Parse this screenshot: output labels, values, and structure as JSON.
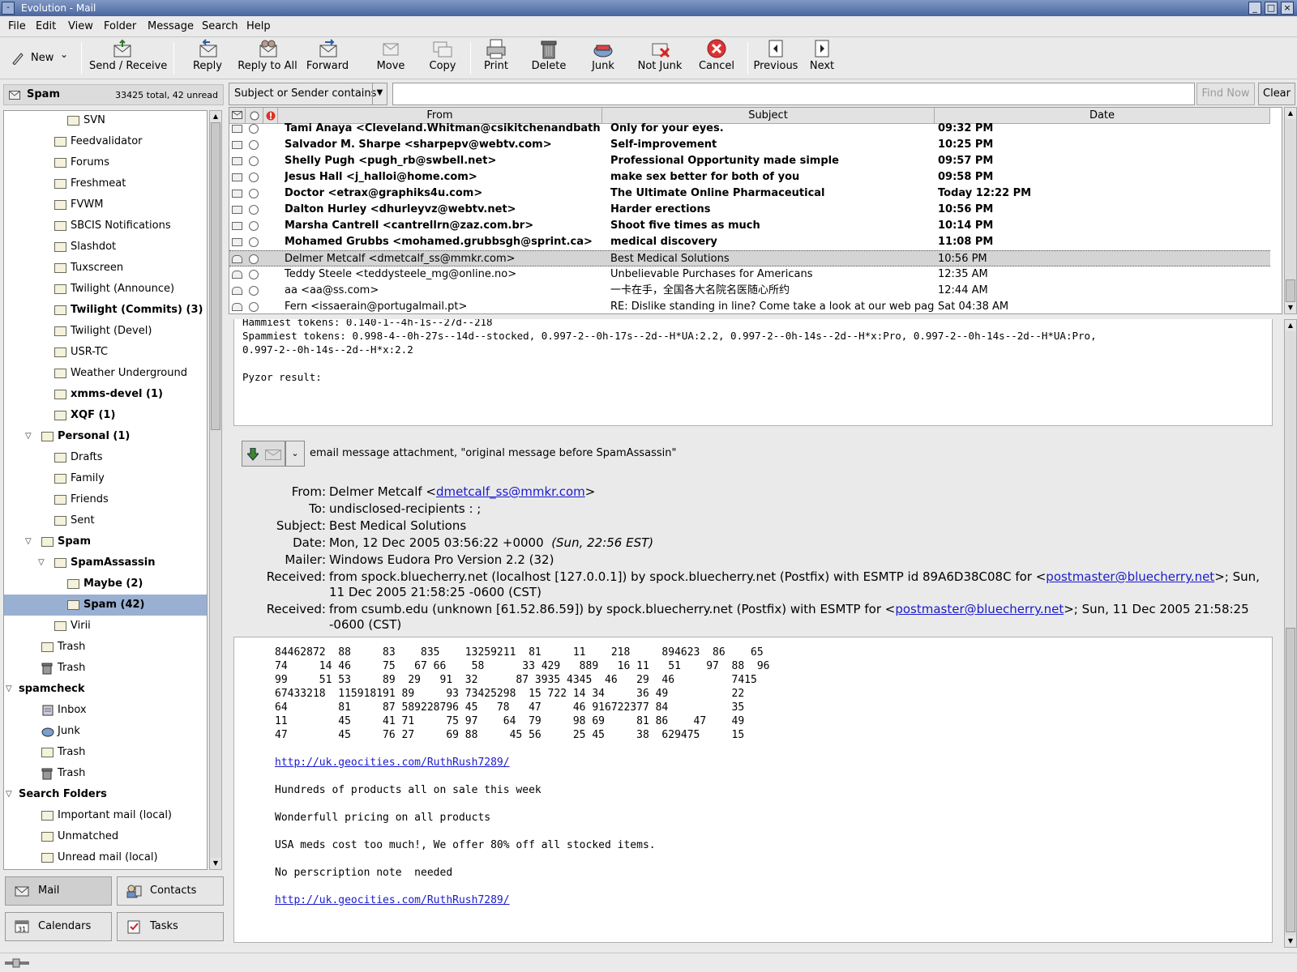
{
  "window": {
    "title": "Evolution - Mail",
    "buttons": [
      "_",
      "□",
      "×"
    ]
  },
  "menu": [
    "File",
    "Edit",
    "View",
    "Folder",
    "Message",
    "Search",
    "Help"
  ],
  "toolbar": {
    "new_label": "New",
    "buttons": [
      {
        "label": "Send / Receive",
        "icon": "send-receive-icon"
      },
      {
        "label": "Reply",
        "icon": "reply-icon"
      },
      {
        "label": "Reply to All",
        "icon": "reply-all-icon"
      },
      {
        "label": "Forward",
        "icon": "forward-icon"
      },
      {
        "label": "Move",
        "icon": "move-icon"
      },
      {
        "label": "Copy",
        "icon": "copy-icon"
      },
      {
        "label": "Print",
        "icon": "print-icon"
      },
      {
        "label": "Delete",
        "icon": "delete-icon"
      },
      {
        "label": "Junk",
        "icon": "junk-icon"
      },
      {
        "label": "Not Junk",
        "icon": "not-junk-icon"
      },
      {
        "label": "Cancel",
        "icon": "cancel-icon"
      },
      {
        "label": "Previous",
        "icon": "previous-icon"
      },
      {
        "label": "Next",
        "icon": "next-icon"
      }
    ]
  },
  "folder_header": {
    "name": "Spam",
    "counts": "33425 total, 42 unread"
  },
  "folders": [
    {
      "label": "SVN",
      "level": 3,
      "bold": false
    },
    {
      "label": "Feedvalidator",
      "level": 2,
      "bold": false
    },
    {
      "label": "Forums",
      "level": 2,
      "bold": false
    },
    {
      "label": "Freshmeat",
      "level": 2,
      "bold": false
    },
    {
      "label": "FVWM",
      "level": 2,
      "bold": false
    },
    {
      "label": "SBCIS Notifications",
      "level": 2,
      "bold": false
    },
    {
      "label": "Slashdot",
      "level": 2,
      "bold": false
    },
    {
      "label": "Tuxscreen",
      "level": 2,
      "bold": false
    },
    {
      "label": "Twilight (Announce)",
      "level": 2,
      "bold": false
    },
    {
      "label": "Twilight (Commits) (3)",
      "level": 2,
      "bold": true
    },
    {
      "label": "Twilight (Devel)",
      "level": 2,
      "bold": false
    },
    {
      "label": "USR-TC",
      "level": 2,
      "bold": false
    },
    {
      "label": "Weather Underground",
      "level": 2,
      "bold": false
    },
    {
      "label": "xmms-devel (1)",
      "level": 2,
      "bold": true
    },
    {
      "label": "XQF (1)",
      "level": 2,
      "bold": true
    },
    {
      "label": "Personal (1)",
      "level": 1,
      "bold": true,
      "expanded": true
    },
    {
      "label": "Drafts",
      "level": 2,
      "bold": false
    },
    {
      "label": "Family",
      "level": 2,
      "bold": false
    },
    {
      "label": "Friends",
      "level": 2,
      "bold": false
    },
    {
      "label": "Sent",
      "level": 2,
      "bold": false
    },
    {
      "label": "Spam",
      "level": 1,
      "bold": true,
      "expanded": true
    },
    {
      "label": "SpamAssassin",
      "level": 2,
      "bold": true,
      "expanded": true
    },
    {
      "label": "Maybe (2)",
      "level": 3,
      "bold": true
    },
    {
      "label": "Spam (42)",
      "level": 3,
      "bold": true,
      "selected": true
    },
    {
      "label": "Virii",
      "level": 2,
      "bold": false
    },
    {
      "label": "Trash",
      "level": 1,
      "bold": false
    },
    {
      "label": "Trash",
      "level": 1,
      "bold": false,
      "icon": "trash"
    },
    {
      "label": "spamcheck",
      "level": 0,
      "bold": true,
      "expanded": true
    },
    {
      "label": "Inbox",
      "level": 1,
      "bold": false,
      "icon": "inbox"
    },
    {
      "label": "Junk",
      "level": 1,
      "bold": false,
      "icon": "junk"
    },
    {
      "label": "Trash",
      "level": 1,
      "bold": false
    },
    {
      "label": "Trash",
      "level": 1,
      "bold": false,
      "icon": "trash"
    },
    {
      "label": "Search Folders",
      "level": 0,
      "bold": true,
      "expanded": true
    },
    {
      "label": "Important mail (local)",
      "level": 1,
      "bold": false
    },
    {
      "label": "Unmatched",
      "level": 1,
      "bold": false
    },
    {
      "label": "Unread mail (local)",
      "level": 1,
      "bold": false
    }
  ],
  "switcher": [
    {
      "label": "Mail",
      "icon": "mail-icon",
      "active": true
    },
    {
      "label": "Contacts",
      "icon": "contacts-icon",
      "active": false
    },
    {
      "label": "Calendars",
      "icon": "calendar-icon",
      "active": false
    },
    {
      "label": "Tasks",
      "icon": "tasks-icon",
      "active": false
    }
  ],
  "search": {
    "filter": "Subject or Sender contains",
    "value": "",
    "find_label": "Find Now",
    "clear_label": "Clear"
  },
  "columns": [
    "From",
    "Subject",
    "Date"
  ],
  "messages": [
    {
      "from": "Tami Anaya <Cleveland.Whitman@csikitchenandbath.com>",
      "subject": "Only for your eyes.",
      "date": "09:32 PM",
      "unread": true
    },
    {
      "from": "Salvador M. Sharpe <sharpepv@webtv.com>",
      "subject": "Self-improvement",
      "date": "10:25 PM",
      "unread": true
    },
    {
      "from": "Shelly Pugh <pugh_rb@swbell.net>",
      "subject": "Professional Opportunity made simple",
      "date": "09:57 PM",
      "unread": true
    },
    {
      "from": "Jesus Hall <j_halloi@home.com>",
      "subject": "make sex better for both of you",
      "date": "09:58 PM",
      "unread": true
    },
    {
      "from": "Doctor <etrax@graphiks4u.com>",
      "subject": "The Ultimate Online Pharmaceutical",
      "date": "Today 12:22 PM",
      "unread": true
    },
    {
      "from": "Dalton Hurley <dhurleyvz@webtv.net>",
      "subject": "Harder erections",
      "date": "10:56 PM",
      "unread": true
    },
    {
      "from": "Marsha Cantrell <cantrellrn@zaz.com.br>",
      "subject": "Shoot five times as much",
      "date": "10:14 PM",
      "unread": true
    },
    {
      "from": "Mohamed Grubbs <mohamed.grubbsgh@sprint.ca>",
      "subject": "medical discovery",
      "date": "11:08 PM",
      "unread": true
    },
    {
      "from": "Delmer Metcalf <dmetcalf_ss@mmkr.com>",
      "subject": "Best Medical Solutions",
      "date": "10:56 PM",
      "unread": false,
      "selected": true
    },
    {
      "from": "Teddy Steele <teddysteele_mg@online.no>",
      "subject": "Unbelievable Purchases for Americans",
      "date": "12:35 AM",
      "unread": false
    },
    {
      "from": "aa <aa@ss.com>",
      "subject": "一卡在手，全国各大名院名医随心所约",
      "date": "12:44 AM",
      "unread": false
    },
    {
      "from": "Fern <issaerain@portugalmail.pt>",
      "subject": "RE: Dislike standing in line? Come take a look at our web page.",
      "date": "Sat 04:38 AM",
      "unread": false
    }
  ],
  "preview": {
    "spam_report": "Hammiest tokens: 0.140-1--4h-1s--27d--218\nSpammiest tokens: 0.998-4--0h-27s--14d--stocked, 0.997-2--0h-17s--2d--H*UA:2.2, 0.997-2--0h-14s--2d--H*x:Pro, 0.997-2--0h-14s--2d--H*UA:Pro,\n0.997-2--0h-14s--2d--H*x:2.2\n\nPyzor result:",
    "attachment_label": "email message attachment, \"original message before SpamAssassin\"",
    "headers": {
      "from_key": "From:",
      "from_name": "Delmer Metcalf <",
      "from_email": "dmetcalf_ss@mmkr.com",
      "from_end": ">",
      "to_key": "To:",
      "to": "undisclosed-recipients : ;",
      "subject_key": "Subject:",
      "subject": "Best Medical Solutions",
      "date_key": "Date:",
      "date": "Mon, 12 Dec 2005 03:56:22 +0000",
      "date_local": "(Sun, 22:56 EST)",
      "mailer_key": "Mailer:",
      "mailer": "Windows Eudora Pro Version 2.2 (32)",
      "received_key": "Received:",
      "received1_a": "from spock.bluecherry.net (localhost [127.0.0.1]) by spock.bluecherry.net (Postfix) with ESMTP id 89A6D38C08C for <",
      "received1_link": "postmaster@bluecherry.net",
      "received1_b": ">; Sun, 11 Dec 2005 21:58:25 -0600 (CST)",
      "received2_a": "from csumb.edu (unknown [61.52.86.59]) by spock.bluecherry.net (Postfix) with ESMTP for <",
      "received2_link": "postmaster@bluecherry.net",
      "received2_b": ">; Sun, 11 Dec 2005 21:58:25 -0600 (CST)"
    },
    "body_numbers": "84462872  88     83    835    13259211  81     11    218     894623  86    65\n74     14 46     75   67 66    58      33 429   889   16 11   51    97  88  96\n99     51 53     89  29   91  32      87 3935 4345  46   29  46         7415\n67433218  115918191 89     93 73425298  15 722 14 34     36 49          22\n64        81     87 589228796 45   78   47     46 916722377 84          35\n11        45     41 71     75 97    64  79     98 69     81 86    47    49\n47        45     76 27     69 88     45 56     25 45     38  629475     15",
    "link1": "http://uk.geocities.com/RuthRush7289/",
    "line1": "Hundreds of products all on sale this week",
    "line2": "Wonderfull pricing on all products",
    "line3": "USA meds cost too much!, We offer 80% off all stocked items.",
    "line4": "No perscription note  needed",
    "link2": "http://uk.geocities.com/RuthRush7289/"
  }
}
